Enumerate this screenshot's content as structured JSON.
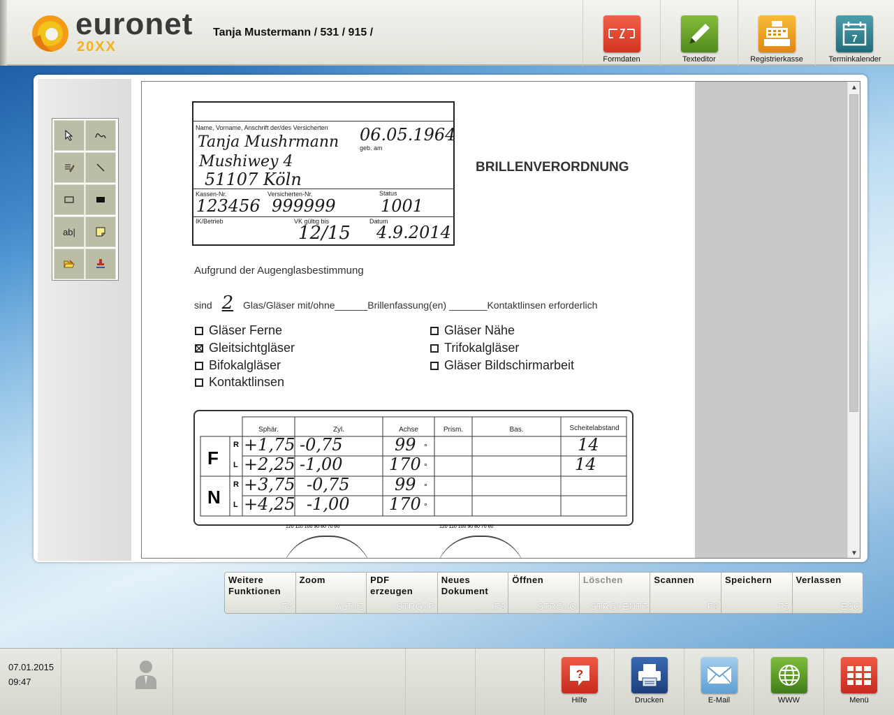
{
  "header": {
    "brand": "euronet",
    "brand_sub": "20XX",
    "patient": "Tanja Mustermann / 531 / 915 /",
    "buttons": [
      {
        "label": "Formdaten",
        "icon": "formdaten-icon",
        "color": "#e8432e"
      },
      {
        "label": "Texteditor",
        "icon": "pencil-icon",
        "color": "#6aa12a"
      },
      {
        "label": "Registrierkasse",
        "icon": "cash-register-icon",
        "color": "#f1a21a"
      },
      {
        "label": "Terminkalender",
        "icon": "calendar-icon",
        "color": "#2f7f8f"
      }
    ]
  },
  "tools": [
    "pointer-icon",
    "freehand-icon",
    "highlighter-icon",
    "line-icon",
    "rectangle-outline-icon",
    "rectangle-filled-icon",
    "text-icon",
    "sticky-note-icon",
    "open-folder-icon",
    "stamp-icon"
  ],
  "tool_text": {
    "text_tool": "ab|"
  },
  "document": {
    "kasse_label": "Name, Vorname, Anschrift der/des Versicherten",
    "name_hand": "Tanja Mushrmann",
    "street_hand": "Mushiwey 4",
    "city_hand": "51107 Köln",
    "dob_hand": "06.05.1964",
    "dob_label": "geb. am",
    "kassen_label": "Kassen-Nr.",
    "vers_label": "Versicherten-Nr.",
    "status_label": "Status",
    "kassen_hand": "123456",
    "vers_hand": "999999",
    "status_hand": "1001",
    "ik_label": "IK/Betrieb",
    "vk_label": "VK gültig bis",
    "datum_label": "Datum",
    "vk_hand": "12/15",
    "datum_hand": "4.9.2014",
    "title": "BRILLENVERORDNUNG",
    "grund": "Aufgrund der Augenglasbestimmung",
    "sind_prefix": "sind",
    "sind_hand": "2",
    "sind_rest": "Glas/Gläser mit/ohne______Brillenfassung(en) _______Kontaktlinsen erforderlich",
    "checkboxes_left": [
      {
        "label": "Gläser Ferne",
        "checked": false
      },
      {
        "label": "Gleitsichtgläser",
        "checked": true
      },
      {
        "label": "Bifokalgläser",
        "checked": false
      },
      {
        "label": "Kontaktlinsen",
        "checked": false
      }
    ],
    "checkboxes_right": [
      {
        "label": "Gläser Nähe",
        "checked": false
      },
      {
        "label": "Trifokalgläser",
        "checked": false
      },
      {
        "label": "Gläser Bildschirmarbeit",
        "checked": false
      }
    ],
    "table_headers": [
      "Sphär.",
      "Zyl.",
      "Achse",
      "Prism.",
      "Bas.",
      "Scheitelabstand"
    ],
    "row_groups": [
      "F",
      "N"
    ],
    "side_labels": [
      "R",
      "L",
      "R",
      "L"
    ],
    "degree_mark": "°",
    "rows": [
      {
        "sph": "+1,75",
        "zyl": "-0,75",
        "achse": "99",
        "scheitel": "14"
      },
      {
        "sph": "+2,25",
        "zyl": "-1,00",
        "achse": "170",
        "scheitel": "14"
      },
      {
        "sph": "+3,75",
        "zyl": "-0,75",
        "achse": "99",
        "scheitel": ""
      },
      {
        "sph": "+4,25",
        "zyl": "-1,00",
        "achse": "170",
        "scheitel": ""
      }
    ],
    "protractor_text": "120 110 100 90 80 70 60"
  },
  "scroll": {
    "up": "▲",
    "down": "▼"
  },
  "function_bar": [
    {
      "label": "Weitere Funktionen",
      "key": "F4",
      "enabled": true
    },
    {
      "label": "Zoom",
      "key": "ALT+Z",
      "enabled": true
    },
    {
      "label": "PDF erzeugen",
      "key": "STRG+P",
      "enabled": true
    },
    {
      "label": "Neues Dokument",
      "key": "F3",
      "enabled": true
    },
    {
      "label": "Öffnen",
      "key": "STRG+O",
      "enabled": true
    },
    {
      "label": "Löschen",
      "key": "STRG+ENTF",
      "enabled": false
    },
    {
      "label": "Scannen",
      "key": "F9",
      "enabled": true
    },
    {
      "label": "Speichern",
      "key": "F5",
      "enabled": true
    },
    {
      "label": "Verlassen",
      "key": "ESC",
      "enabled": true
    }
  ],
  "footer": {
    "date": "07.01.2015",
    "time": "09:47",
    "buttons": [
      {
        "label": "Hilfe",
        "icon": "help-icon",
        "color": "#d9352a"
      },
      {
        "label": "Drucken",
        "icon": "printer-icon",
        "color": "#24508f"
      },
      {
        "label": "E-Mail",
        "icon": "envelope-icon",
        "color": "#7db6e0"
      },
      {
        "label": "WWW",
        "icon": "globe-icon",
        "color": "#5a9e2a"
      },
      {
        "label": "Menü",
        "icon": "menu-grid-icon",
        "color": "#d9352a"
      }
    ]
  }
}
